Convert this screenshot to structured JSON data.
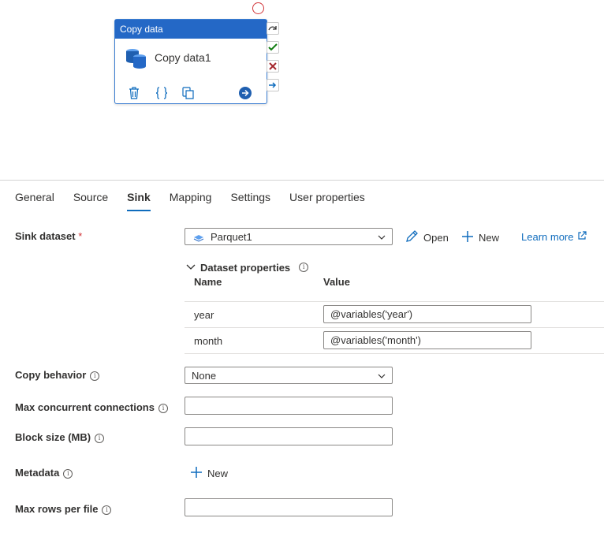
{
  "canvas": {
    "activity": {
      "type_label": "Copy data",
      "name": "Copy data1",
      "tools": [
        "delete-icon",
        "code-icon",
        "clone-icon",
        "arrow-right-icon"
      ]
    },
    "side_buttons": [
      "skip-icon",
      "success-check-icon",
      "failure-x-icon",
      "completion-arrow-icon"
    ]
  },
  "tabs": [
    "General",
    "Source",
    "Sink",
    "Mapping",
    "Settings",
    "User properties"
  ],
  "active_tab": "Sink",
  "sink": {
    "dataset_label": "Sink dataset",
    "required_mark": "*",
    "dataset_value": "Parquet1",
    "open_label": "Open",
    "new_label": "New",
    "learn_more_label": "Learn more",
    "dataset_properties_label": "Dataset properties",
    "columns": {
      "name": "Name",
      "value": "Value"
    },
    "properties": [
      {
        "name": "year",
        "value": "@variables('year')"
      },
      {
        "name": "month",
        "value": "@variables('month')"
      }
    ],
    "copy_behavior_label": "Copy behavior",
    "copy_behavior_value": "None",
    "max_conn_label": "Max concurrent connections",
    "max_conn_value": "",
    "block_size_label": "Block size (MB)",
    "block_size_value": "",
    "metadata_label": "Metadata",
    "metadata_new_label": "New",
    "max_rows_label": "Max rows per file",
    "max_rows_value": ""
  },
  "colors": {
    "accent": "#0f6cbd",
    "header": "#2468c6",
    "required": "#d13438"
  }
}
